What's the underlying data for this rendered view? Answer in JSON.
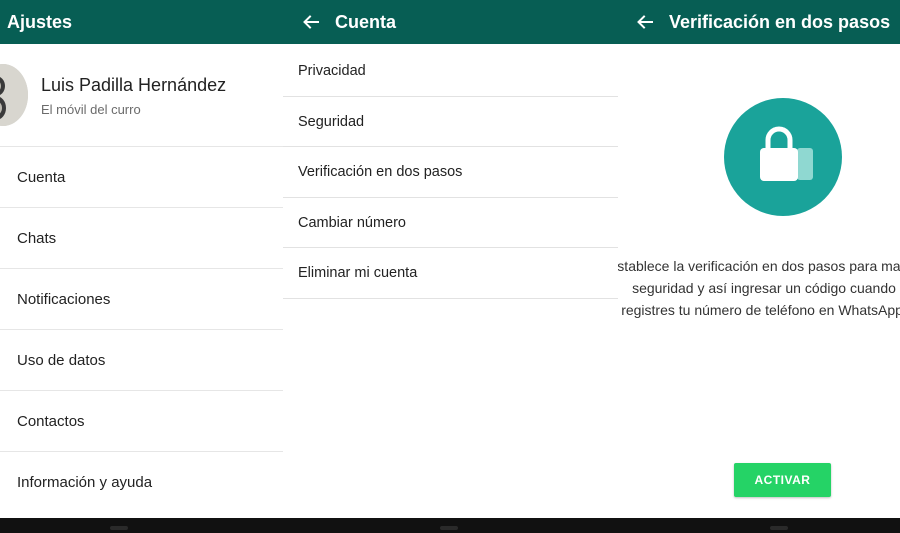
{
  "colors": {
    "appbar": "#075e54",
    "accent": "#25d366",
    "lock_circle": "#1aa39a"
  },
  "ajustes": {
    "title": "Ajustes",
    "profile": {
      "name": "Luis Padilla Hernández",
      "status": "El móvil del curro"
    },
    "items": [
      "Cuenta",
      "Chats",
      "Notificaciones",
      "Uso de datos",
      "Contactos",
      "Información y ayuda"
    ]
  },
  "cuenta": {
    "title": "Cuenta",
    "back_icon": "arrow-left-icon",
    "items": [
      "Privacidad",
      "Seguridad",
      "Verificación en dos pasos",
      "Cambiar número",
      "Eliminar mi cuenta"
    ]
  },
  "verificacion": {
    "title": "Verificación en dos pasos",
    "back_icon": "arrow-left-icon",
    "icon": "lock-icon",
    "description": "Establece la verificación en dos pasos para mayor seguridad y así ingresar un código cuando registres tu número de teléfono en WhatsApp.",
    "button_label": "ACTIVAR"
  }
}
